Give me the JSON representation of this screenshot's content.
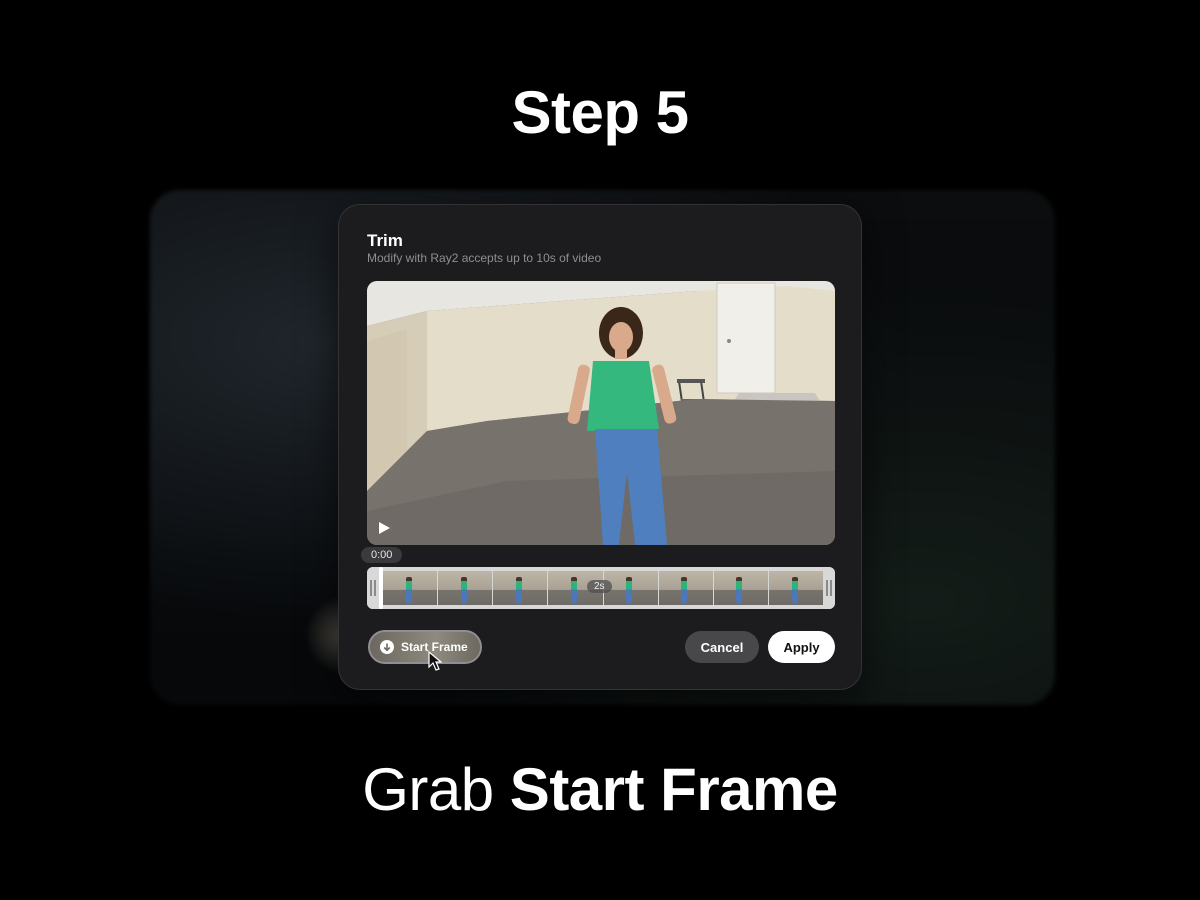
{
  "step_title": "Step 5",
  "caption": {
    "light": "Grab",
    "bold": "Start Frame"
  },
  "dialog": {
    "title": "Trim",
    "subtitle": "Modify with Ray2 accepts up to 10s of video",
    "current_time": "0:00",
    "timeline_marker": "2s",
    "start_frame_label": "Start Frame",
    "cancel_label": "Cancel",
    "apply_label": "Apply"
  },
  "icons": {
    "play": "play-icon",
    "download": "arrow-down-icon",
    "cursor": "cursor-icon"
  },
  "colors": {
    "background": "#000000",
    "dialog": "#1c1c1e",
    "cancel_button": "#48484a",
    "apply_button": "#ffffff"
  }
}
